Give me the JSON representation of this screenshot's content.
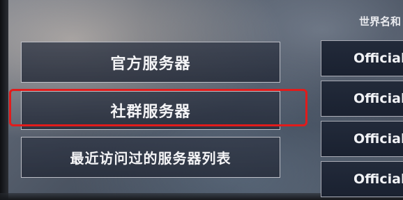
{
  "menu": {
    "official_servers": "官方服务器",
    "community_servers": "社群服务器",
    "recent_servers": "最近访问过的服务器列表"
  },
  "server_panel": {
    "header": "世界名和",
    "rows": [
      {
        "name": "Official"
      },
      {
        "name": "Official"
      },
      {
        "name": "Official"
      },
      {
        "name": "Official J"
      }
    ]
  },
  "colors": {
    "highlight": "#e11b1b",
    "button_bg": "#30374a",
    "panel_bg": "#1e2534"
  }
}
